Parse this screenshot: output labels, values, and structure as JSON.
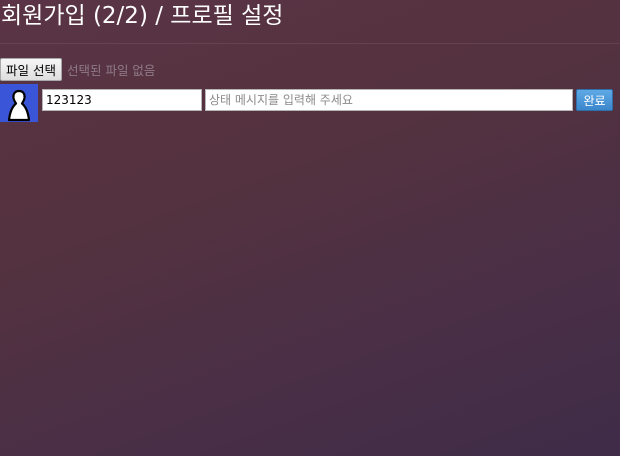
{
  "header": {
    "title": "회원가입 (2/2) / 프로필 설정"
  },
  "file_picker": {
    "button_label": "파일 선택",
    "status_text": "선택된 파일 없음"
  },
  "profile": {
    "avatar_icon": "default-user-silhouette-icon",
    "nickname_value": "123123",
    "status_placeholder": "상태 메시지를 입력해 주세요",
    "status_value": "",
    "submit_label": "완료"
  },
  "colors": {
    "avatar_background": "#3a55d8",
    "submit_button": "#4a97d9"
  }
}
